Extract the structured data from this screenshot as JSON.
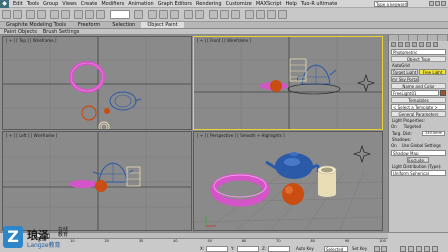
{
  "menubar": {
    "items": [
      "Edit",
      "Tools",
      "Group",
      "Views",
      "Create",
      "Modifiers",
      "Animation",
      "Graph Editors",
      "Rendering",
      "Customize",
      "MAXScript",
      "Help",
      "Tuo-R ultimate"
    ],
    "workspace": "Workspace: Default",
    "search": "Type a keyword or phrase"
  },
  "ribbon": {
    "tabs": [
      "Graphite Modeling Tools",
      "Freeform",
      "Selection",
      "Object Paint"
    ],
    "active_index": 3,
    "sub": [
      "Paint Objects",
      "Brush Settings"
    ]
  },
  "viewports": {
    "top": "[ + ] [ Top ] [ Wireframe ]",
    "front": "[ + ] [ Front ] [ Wireframe ]",
    "left": "[ + ] [ Left ] [ Wireframe ]",
    "perspective": "[ + ] [ Perspective ] [ Smooth + Highlights ]"
  },
  "command_panel": {
    "category": "Photometric",
    "object_type_header": "Object Type",
    "autogrid": "AutoGrid",
    "btn_target": "Target Light",
    "btn_free": "Free Light",
    "btn_sky": "mr Sky Portal",
    "name_color_header": "Name and Color",
    "name_value": "FreeLight01",
    "templates_header": "Templates",
    "template_select": "< Select a Template >",
    "general_header": "General Parameters",
    "light_props": "Light Properties:",
    "on_label": "On",
    "targeted_label": "Targeted",
    "targ_dist_label": "Targ. Dist:",
    "targ_dist_value": "240.0mm",
    "shadows": "Shadows:",
    "shadows_on": "On",
    "global": "Use Global Settings",
    "shadow_type": "Shadow Map",
    "exclude": "Exclude...",
    "distribution": "Light Distribution (Type):",
    "distribution_value": "Uniform Spherical"
  },
  "status": {
    "frame": "0 / 100",
    "selected": "Selected",
    "x_label": "X:",
    "y_label": "Y:",
    "z_label": "Z:",
    "key_label": "Auto Key",
    "set_key": "Set Key",
    "ticks": [
      "0",
      "10",
      "20",
      "30",
      "40",
      "50",
      "60",
      "70",
      "80",
      "90",
      "100"
    ]
  },
  "watermark": {
    "mark": "Z",
    "t1": "琅泽",
    "t2": "在线 教育",
    "t3": "Langze教育"
  },
  "colors": {
    "active_viewport": "#e6d232",
    "torus": "#d455c8",
    "teapot": "#2a5aa8",
    "sphere": "#c94d10",
    "cylinder": "#e8ddb5"
  }
}
